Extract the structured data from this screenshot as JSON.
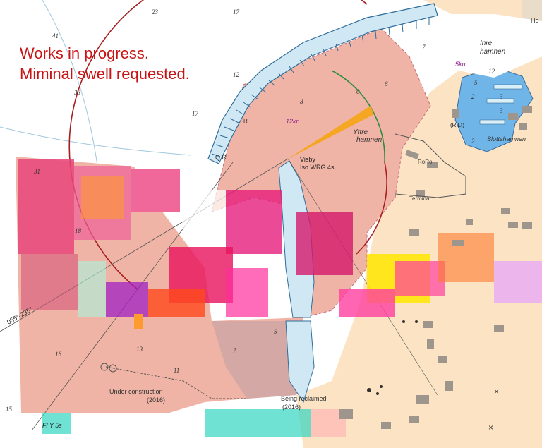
{
  "notice": {
    "line1": "Works in progress.",
    "line2": "Miminal swell requested."
  },
  "harbour_names": {
    "inner_1": "Inre",
    "inner_2": "hamnen",
    "outer_1": "Yttre",
    "outer_2": "hamnen",
    "slots": "Slottshamnen",
    "top_right": "Ho"
  },
  "lights": {
    "visby_1": "Visby",
    "visby_2": "Iso WRG 4s",
    "qr": "Q R",
    "r": "R",
    "rlt": "(R Lt)",
    "fly": "Fl Y 5s",
    "bearing": "055°-235°"
  },
  "speeds": {
    "inner": "5kn",
    "outer": "12kn"
  },
  "quay_labels": {
    "roro": "RoRo",
    "terminal": "Terminal"
  },
  "works": {
    "construction_1": "Under construction",
    "construction_2": "(2016)",
    "reclaimed_1": "Being reclaimed",
    "reclaimed_2": "(2016)"
  },
  "depths": {
    "d23": "23",
    "d17a": "17",
    "d41": "41",
    "d33": "33",
    "d12": "12",
    "d17b": "17",
    "d31": "31",
    "d18": "18",
    "d16": "16",
    "d13": "13",
    "d11": "11",
    "d7": "7",
    "d5": "5",
    "d15": "15",
    "d8": "8",
    "d0": "0",
    "d6": "6",
    "d7b": "7",
    "d2a": "2",
    "d3a": "3",
    "d3b": "3",
    "d2b": "2",
    "d5b": "5",
    "d12c": "12"
  },
  "colors": {
    "land": "#fbe3c4",
    "water": "#ffffff",
    "works_area": "#f0b4a6",
    "basin": "#6fb5e8",
    "pier": "#d9eff8",
    "arc": "#a61e1e",
    "notice": "#c81414"
  }
}
